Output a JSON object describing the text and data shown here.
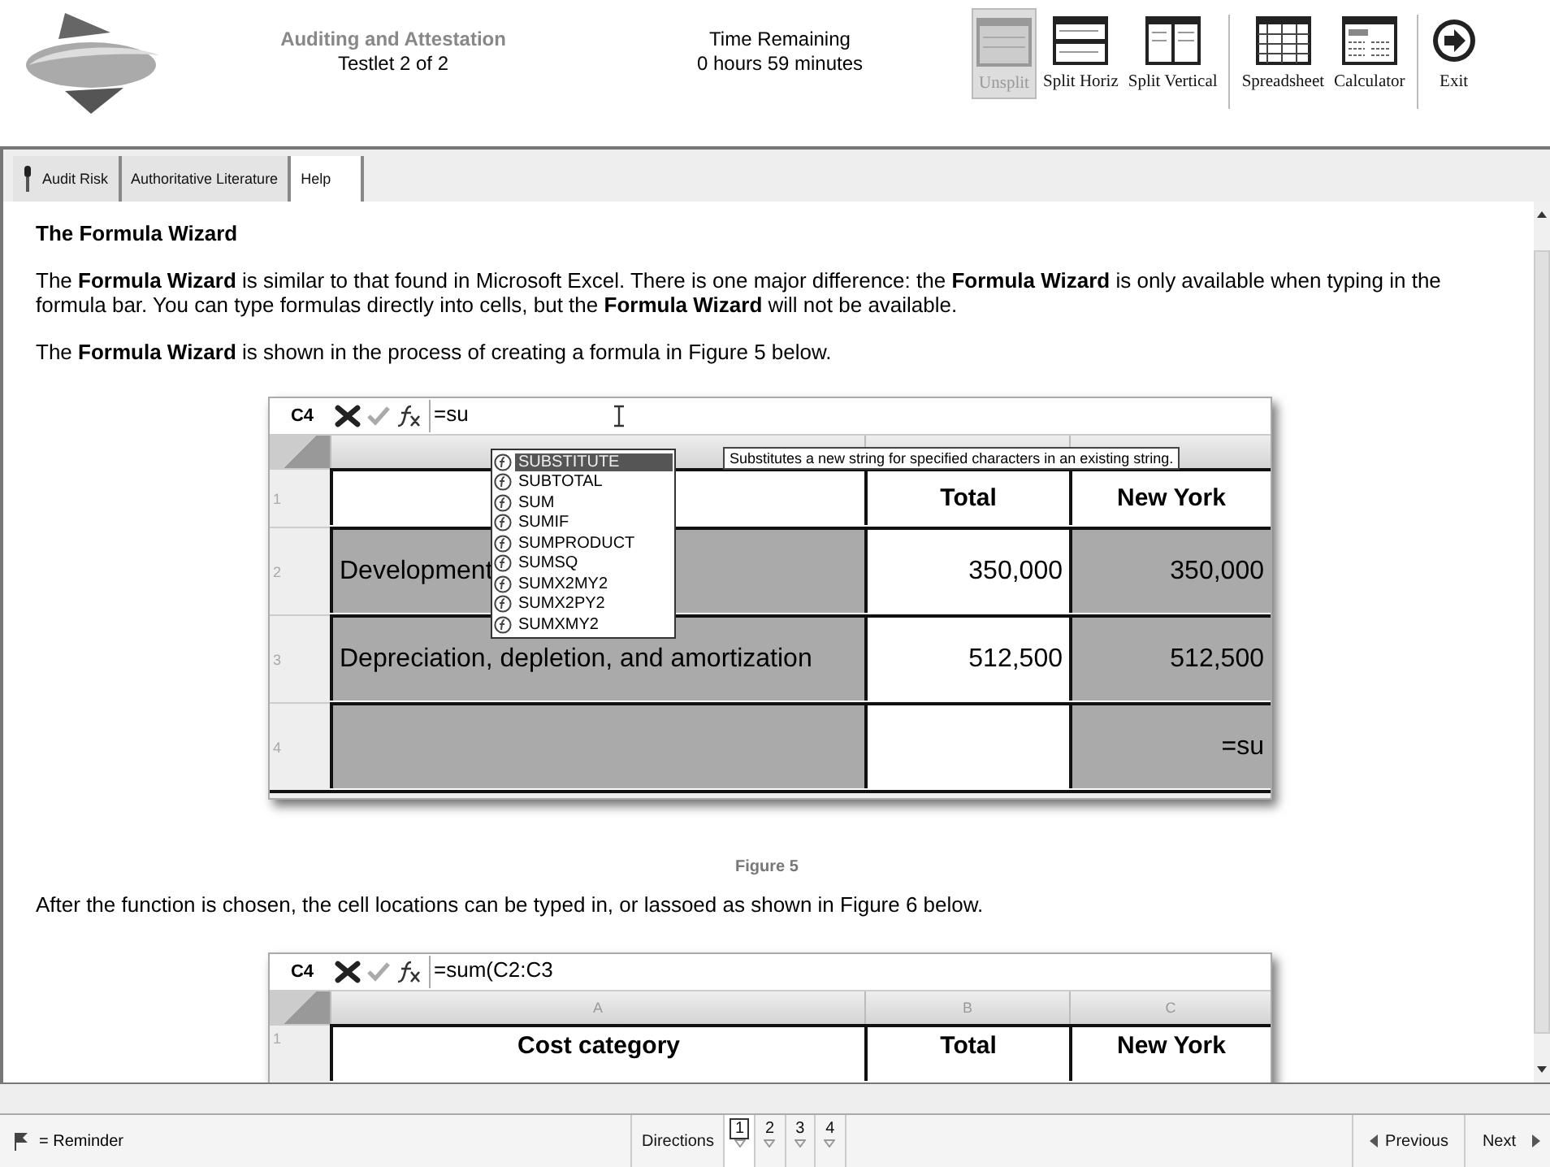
{
  "header": {
    "exam_title": "Auditing and Attestation",
    "testlet": "Testlet 2 of 2",
    "time_label": "Time Remaining",
    "time_value": "0 hours 59 minutes"
  },
  "toolbar": [
    {
      "label": "Unsplit",
      "kind": "unsplit",
      "disabled": true
    },
    {
      "label": "Split Horiz",
      "kind": "split-horiz",
      "disabled": false
    },
    {
      "label": "Split Vertical",
      "kind": "split-vert",
      "disabled": false
    },
    {
      "label": "Spreadsheet",
      "kind": "spreadsheet",
      "disabled": false
    },
    {
      "label": "Calculator",
      "kind": "calculator",
      "disabled": false
    },
    {
      "label": "Exit",
      "kind": "exit",
      "disabled": false
    }
  ],
  "tabs": [
    {
      "label": "Audit Risk",
      "selected": false
    },
    {
      "label": "Authoritative Literature",
      "selected": false
    },
    {
      "label": "Help",
      "selected": true
    }
  ],
  "content": {
    "heading": "The Formula Wizard",
    "paragraphs": [
      "The **Formula Wizard** is similar to that found in Microsoft Excel.  There is one major difference: the **Formula Wizard** is only available when typing in the formula bar.  You can type formulas directly into cells, but the **Formula Wizard** will not be available.",
      "The **Formula Wizard** is shown in the process of creating a formula in Figure 5 below."
    ],
    "figure_1": {
      "cell_ref": "C4",
      "formula": "=su",
      "rows": [
        {
          "number": "1",
          "kind": "header",
          "cells": [
            {
              "text": "",
              "shaded": false
            },
            {
              "text": "Total",
              "shaded": false
            },
            {
              "text": "New York",
              "shaded": false
            }
          ]
        },
        {
          "number": "2",
          "kind": "data",
          "cells": [
            {
              "text": "Development",
              "shaded": true
            },
            {
              "text": "350,000",
              "shaded": false
            },
            {
              "text": "350,000",
              "shaded": true
            }
          ]
        },
        {
          "number": "3",
          "kind": "data",
          "cells": [
            {
              "text": "Depreciation, depletion, and amortization",
              "shaded": true
            },
            {
              "text": "512,500",
              "shaded": false
            },
            {
              "text": "512,500",
              "shaded": true
            }
          ]
        },
        {
          "number": "4",
          "kind": "data",
          "cells": [
            {
              "text": "",
              "shaded": true
            },
            {
              "text": "",
              "shaded": false
            },
            {
              "text": "=su",
              "shaded": true
            }
          ]
        }
      ],
      "suggestions": [
        {
          "label": "SUBSTITUTE",
          "selected": true
        },
        {
          "label": "SUBTOTAL",
          "selected": false
        },
        {
          "label": "SUM",
          "selected": false
        },
        {
          "label": "SUMIF",
          "selected": false
        },
        {
          "label": "SUMPRODUCT",
          "selected": false
        },
        {
          "label": "SUMSQ",
          "selected": false
        },
        {
          "label": "SUMX2MY2",
          "selected": false
        },
        {
          "label": "SUMX2PY2",
          "selected": false
        },
        {
          "label": "SUMXMY2",
          "selected": false
        }
      ],
      "tooltip": "Substitutes a new string for specified characters in an existing string."
    },
    "caption": "Figure 5",
    "paragraph_2": "After the function is chosen, the cell locations can be typed in, or lassoed as shown in Figure 6 below.",
    "figure_2": {
      "cell_ref": "C4",
      "formula": "=sum(C2:C3",
      "columns": [
        "A",
        "B",
        "C"
      ],
      "rows": [
        {
          "number": "1",
          "kind": "header",
          "cells": [
            {
              "text": "Cost category",
              "shaded": false
            },
            {
              "text": "Total",
              "shaded": false
            },
            {
              "text": "New York",
              "shaded": false
            }
          ]
        }
      ]
    }
  },
  "status_bar": {
    "reminder": "= Reminder",
    "directions": "Directions",
    "pages": [
      {
        "label": "1",
        "selected": true
      },
      {
        "label": "2",
        "selected": false
      },
      {
        "label": "3",
        "selected": false
      },
      {
        "label": "4",
        "selected": false
      }
    ],
    "previous": "Previous",
    "next": "Next"
  }
}
